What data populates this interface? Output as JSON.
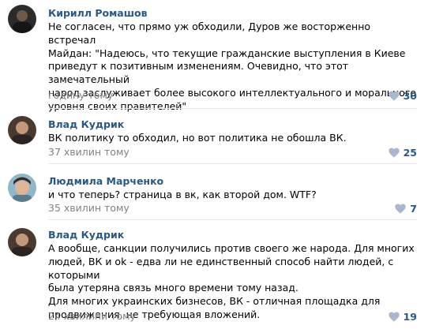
{
  "colors": {
    "author": "#2a5885",
    "time": "#828282",
    "heart": "#a9b8cc",
    "divider": "#e7e8ec"
  },
  "comments": [
    {
      "author": "Кирилл Ромашов",
      "text": "Не согласен, что прямо уж обходили, Дуров же восторженно встречал\nМайдан: \"Надеюсь, что текущие гражданские выступления в Киеве\nприведут к позитивным изменениям. Очевидно, что этот замечательный\nнарод заслуживает более высокого интеллектуального и морального\nуровня своих правителей\"",
      "time": "годину тому",
      "likes": "30",
      "icon": "heart-icon"
    },
    {
      "author": "Влад Кудрик",
      "text": "ВК политику то обходил, но вот политика не обошла ВК.",
      "time": "37 хвилин тому",
      "likes": "25",
      "icon": "heart-icon"
    },
    {
      "author": "Людмила Марченко",
      "text": "и что теперь? страница в вк, как второй дом. WTF?",
      "time": "35 хвилин тому",
      "likes": "7",
      "icon": "heart-icon"
    },
    {
      "author": "Влад Кудрик",
      "text": "А вообще, санкции получились против своего же народа. Для многих\nлюдей, ВК и ok - едва ли не единственный способ найти людей, с которыми\nбыла утеряна связь много времени тому назад.\nДля многих украинских бизнесов, ВК - отличная площадка для\nпродвижения, не требующая вложений.",
      "time": "24 хвилини тому",
      "likes": "19",
      "icon": "heart-icon"
    }
  ]
}
